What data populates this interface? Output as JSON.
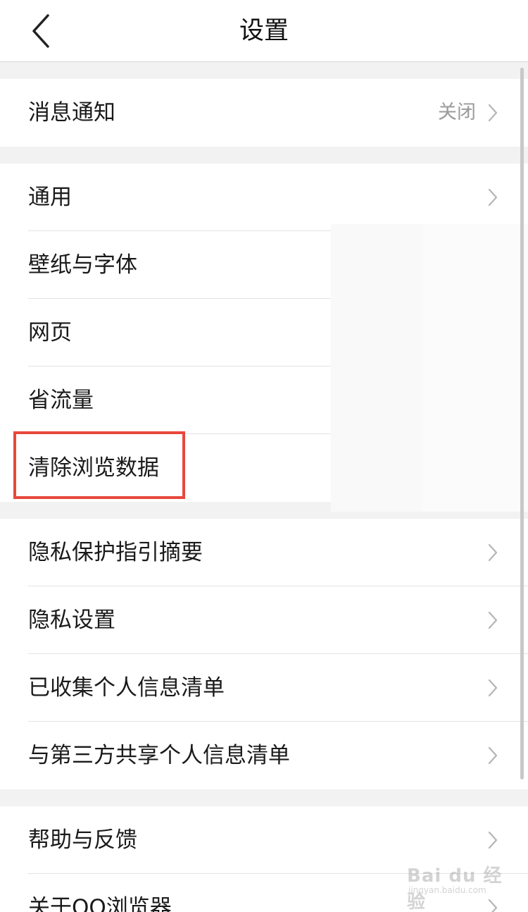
{
  "header": {
    "title": "设置",
    "back_icon": "chevron-left-icon"
  },
  "groups": [
    {
      "items": [
        {
          "label": "消息通知",
          "value": "关闭"
        }
      ]
    },
    {
      "items": [
        {
          "label": "通用"
        },
        {
          "label": "壁纸与字体"
        },
        {
          "label": "网页"
        },
        {
          "label": "省流量"
        },
        {
          "label": "清除浏览数据",
          "highlighted": true
        }
      ]
    },
    {
      "items": [
        {
          "label": "隐私保护指引摘要"
        },
        {
          "label": "隐私设置"
        },
        {
          "label": "已收集个人信息清单"
        },
        {
          "label": "与第三方共享个人信息清单"
        }
      ]
    },
    {
      "items": [
        {
          "label": "帮助与反馈"
        },
        {
          "label": "关于QQ浏览器"
        }
      ]
    }
  ],
  "watermark": {
    "main": "Bai du 经验",
    "sub": "jingyan.baidu.com"
  },
  "colors": {
    "highlight": "#e8483c",
    "secondary_text": "#9a9a9a",
    "background": "#f2f2f2"
  }
}
